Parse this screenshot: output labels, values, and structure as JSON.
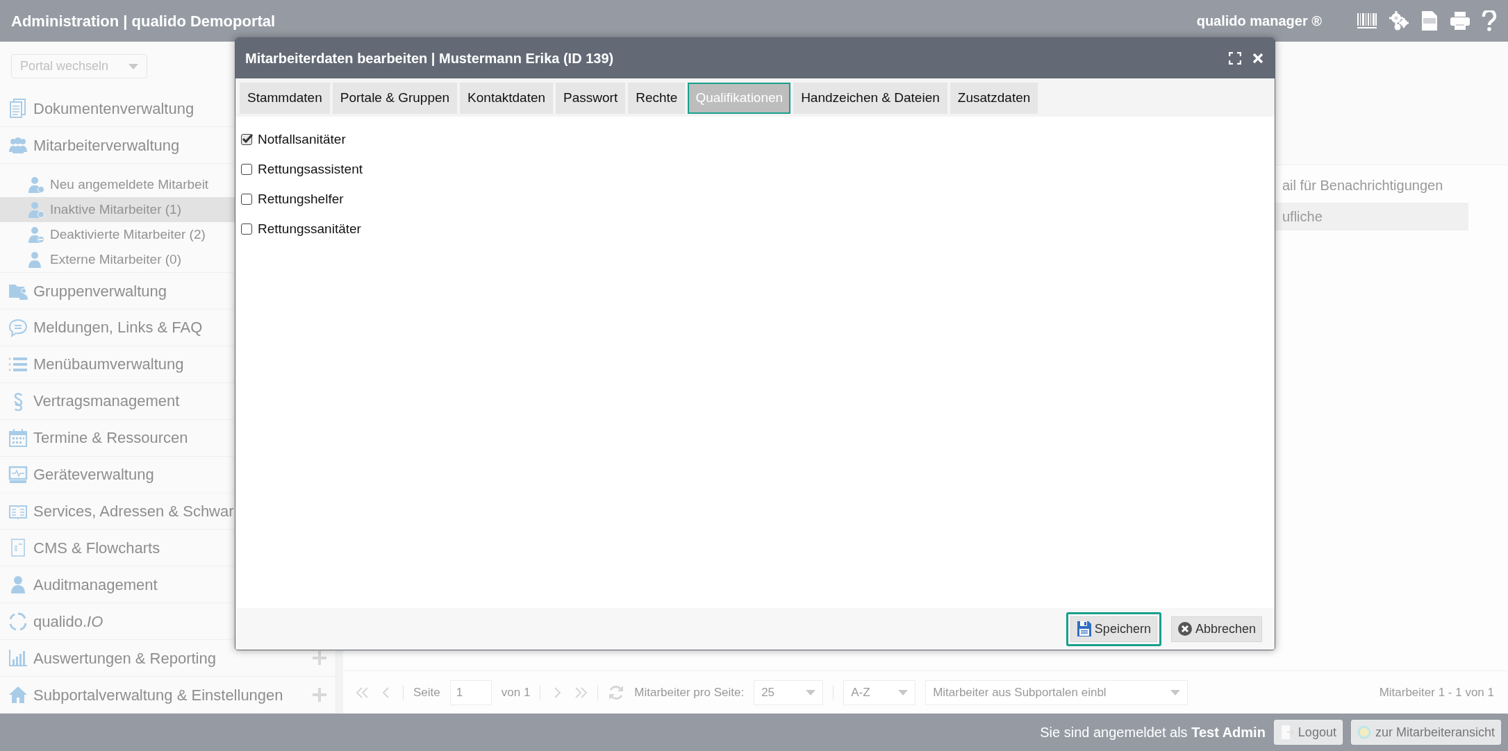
{
  "top_bar": {
    "title": "Administration | qualido Demoportal",
    "product": "qualido manager ®"
  },
  "sidebar": {
    "portal_select": {
      "value": "Portal wechseln"
    },
    "items": [
      {
        "label": "Dokumentenverwaltung"
      },
      {
        "label": "Mitarbeiterverwaltung",
        "children": [
          {
            "label": "Neu angemeldete Mitarbeit",
            "selected": false
          },
          {
            "label": "Inaktive Mitarbeiter (1)",
            "selected": true
          },
          {
            "label": "Deaktivierte Mitarbeiter (2)",
            "selected": false
          },
          {
            "label": "Externe Mitarbeiter (0)",
            "selected": false
          }
        ]
      },
      {
        "label": "Gruppenverwaltung"
      },
      {
        "label": "Meldungen, Links & FAQ"
      },
      {
        "label": "Menübaumverwaltung"
      },
      {
        "label": "Vertragsmanagement"
      },
      {
        "label": "Termine & Ressourcen"
      },
      {
        "label": "Geräteverwaltung"
      },
      {
        "label": "Services, Adressen & Schwar"
      },
      {
        "label": "CMS & Flowcharts"
      },
      {
        "label": "Auditmanagement"
      },
      {
        "label": "qualido.*IO*"
      },
      {
        "label": "Auswertungen & Reporting",
        "expandable": true
      },
      {
        "label": "Subportalverwaltung & Einstellungen",
        "expandable": true
      }
    ]
  },
  "main": {
    "field_label": "ail für Benachrichtigungen",
    "field_value": "ufliche"
  },
  "pagination": {
    "page_label": "Seite",
    "page": "1",
    "page_count": "von 1",
    "per_page_label": "Mitarbeiter pro Seite:",
    "per_page": "25",
    "sort": "A-Z",
    "subportal_filter": "Mitarbeiter aus Subportalen einbl",
    "summary": "Mitarbeiter 1 - 1 von 1"
  },
  "status_bar": {
    "login_text": "Sie sind angemeldet als **Test Admin**",
    "buttons": [
      {
        "label": "Logout",
        "kind": "logout"
      },
      {
        "label": "zur Mitarbeiteransicht",
        "kind": "view"
      }
    ]
  },
  "modal": {
    "title": "Mitarbeiterdaten bearbeiten | Mustermann Erika (ID 139)",
    "tabs": [
      {
        "label": "Stammdaten",
        "selected": false
      },
      {
        "label": "Portale & Gruppen",
        "selected": false
      },
      {
        "label": "Kontaktdaten",
        "selected": false
      },
      {
        "label": "Passwort",
        "selected": false
      },
      {
        "label": "Rechte",
        "selected": false
      },
      {
        "label": "Qualifikationen",
        "selected": true
      },
      {
        "label": "Handzeichen & Dateien",
        "selected": false
      },
      {
        "label": "Zusatzdaten",
        "selected": false
      }
    ],
    "qualifications": [
      {
        "label": "Notfallsanitäter",
        "checked": true
      },
      {
        "label": "Rettungsassistent",
        "checked": false
      },
      {
        "label": "Rettungshelfer",
        "checked": false
      },
      {
        "label": "Rettungssanitäter",
        "checked": false
      }
    ],
    "buttons": [
      {
        "label": "Speichern",
        "kind": "save",
        "focused": true
      },
      {
        "label": "Abbrechen",
        "kind": "cancel",
        "focused": false
      }
    ]
  }
}
